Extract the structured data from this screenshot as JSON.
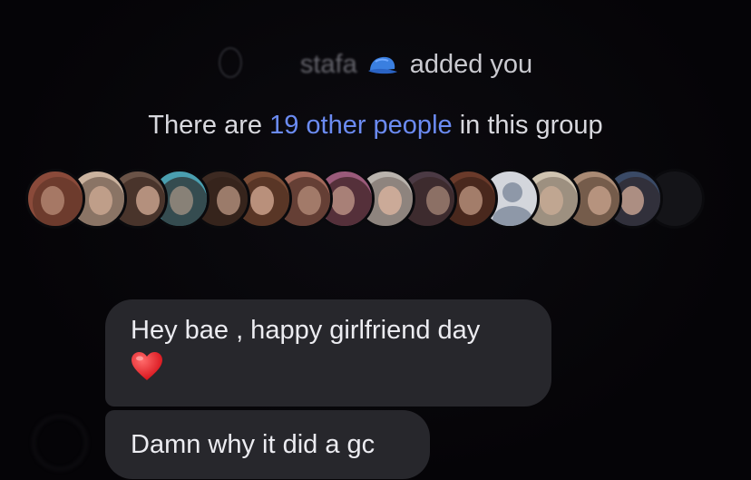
{
  "system": {
    "added_name": "stafa",
    "cap_icon": "blue-cap-emoji",
    "added_text": "added you"
  },
  "group_info": {
    "prefix": "There are",
    "link": "19 other people",
    "suffix": "in this group"
  },
  "member_avatars": [
    {
      "name": "member-avatar",
      "bg": "#8a4a3a",
      "style": "photo"
    },
    {
      "name": "member-avatar",
      "bg": "#cbb39f",
      "style": "photo"
    },
    {
      "name": "member-avatar",
      "bg": "#6a5347",
      "style": "photo"
    },
    {
      "name": "member-avatar",
      "bg": "#4a9fb0",
      "style": "photo"
    },
    {
      "name": "member-avatar",
      "bg": "#3d2a22",
      "style": "photo"
    },
    {
      "name": "member-avatar",
      "bg": "#7a4c36",
      "style": "photo"
    },
    {
      "name": "member-avatar",
      "bg": "#a2685a",
      "style": "photo"
    },
    {
      "name": "member-avatar",
      "bg": "#9a5a7a",
      "style": "photo"
    },
    {
      "name": "member-avatar",
      "bg": "#b9b3ad",
      "style": "photo"
    },
    {
      "name": "member-avatar",
      "bg": "#4b3a44",
      "style": "photo"
    },
    {
      "name": "member-avatar",
      "bg": "#6a3a2a",
      "style": "photo"
    },
    {
      "name": "member-avatar",
      "bg": "#d3d6dc",
      "style": "placeholder"
    },
    {
      "name": "member-avatar",
      "bg": "#cfc3b0",
      "style": "photo"
    },
    {
      "name": "member-avatar",
      "bg": "#a98a74",
      "style": "photo"
    },
    {
      "name": "member-avatar",
      "bg": "#3a4a66",
      "style": "photo"
    },
    {
      "name": "member-avatar",
      "bg": "#141418",
      "style": "dark"
    }
  ],
  "messages": [
    {
      "text": "Hey bae , happy girlfriend day",
      "emoji": "red-heart-emoji"
    },
    {
      "text": "Damn why it did a gc"
    }
  ]
}
